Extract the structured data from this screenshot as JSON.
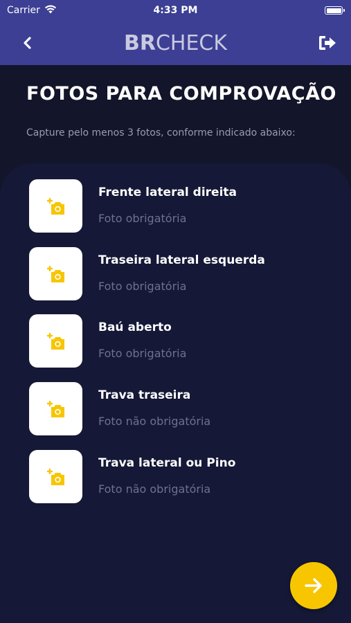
{
  "status_bar": {
    "carrier": "Carrier",
    "time": "4:33 PM"
  },
  "nav": {
    "brand_bold": "BR",
    "brand_light": "CHECK"
  },
  "page": {
    "title": "FOTOS PARA COMPROVAÇÃO",
    "subtitle": "Capture pelo menos 3 fotos, conforme indicado abaixo:"
  },
  "photos": [
    {
      "label": "Frente lateral direita",
      "status": "Foto obrigatória",
      "icon": "add-photo-icon"
    },
    {
      "label": "Traseira lateral esquerda",
      "status": "Foto obrigatória",
      "icon": "add-photo-icon"
    },
    {
      "label": "Baú aberto",
      "status": "Foto obrigatória",
      "icon": "add-photo-icon"
    },
    {
      "label": "Trava traseira",
      "status": "Foto não obrigatória",
      "icon": "add-photo-icon"
    },
    {
      "label": "Trava lateral ou Pino",
      "status": "Foto não obrigatória",
      "icon": "add-photo-icon"
    }
  ],
  "colors": {
    "nav_bg": "#3c3f94",
    "page_bg": "#13152a",
    "card_bg": "#151836",
    "accent": "#f7c600",
    "muted_text": "#6e7190"
  }
}
